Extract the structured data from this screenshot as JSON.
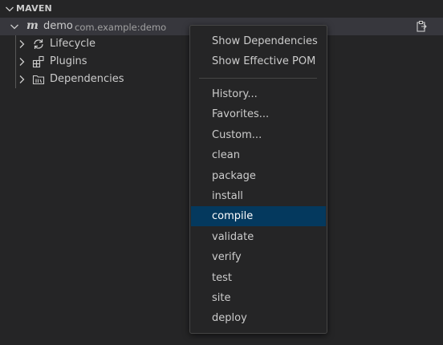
{
  "section": {
    "title": "MAVEN"
  },
  "tree": {
    "project": {
      "name": "demo",
      "description": "com.example:demo",
      "icon": "maven-m-icon"
    },
    "children": [
      {
        "label": "Lifecycle",
        "icon": "refresh-icon"
      },
      {
        "label": "Plugins",
        "icon": "extensions-icon"
      },
      {
        "label": "Dependencies",
        "icon": "library-icon"
      }
    ]
  },
  "menu": {
    "group1": [
      "Show Dependencies",
      "Show Effective POM"
    ],
    "group2": [
      "History...",
      "Favorites...",
      "Custom...",
      "clean",
      "package",
      "install",
      "compile",
      "validate",
      "verify",
      "test",
      "site",
      "deploy"
    ],
    "active_item": "compile"
  },
  "colors": {
    "selection": "#04395e",
    "background": "#252526",
    "row_selected": "#37373d"
  }
}
